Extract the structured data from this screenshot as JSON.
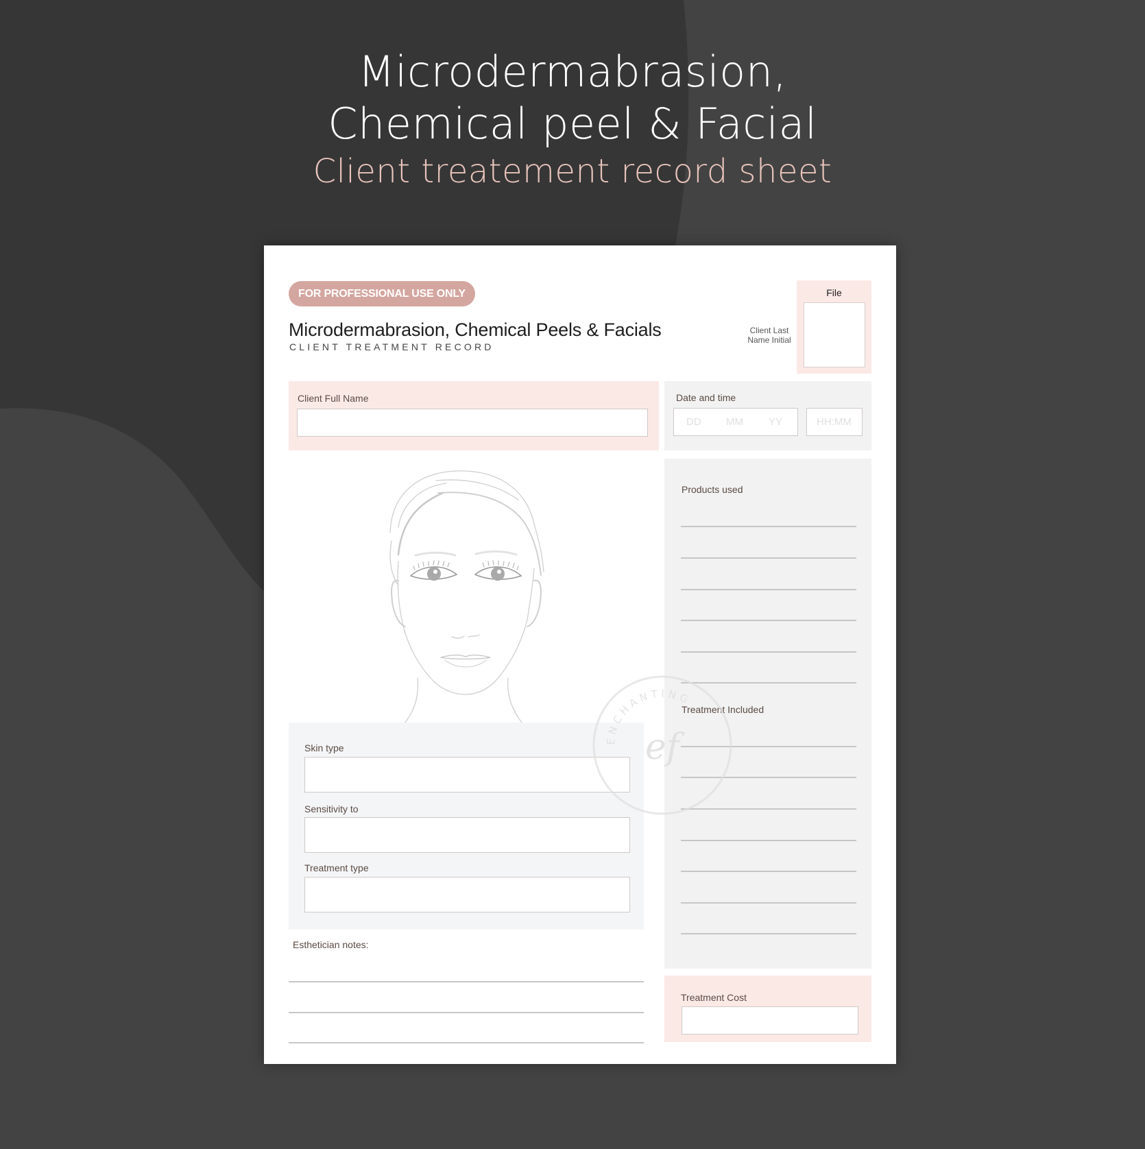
{
  "hero": {
    "line1": "Microdermabrasion,",
    "line2": "Chemical peel & Facial",
    "subtitle": "Client treatement record sheet"
  },
  "colors": {
    "background_dark": "#363636",
    "background_mid": "#434343",
    "accent_pink": "#d4a6a0",
    "panel_pink": "#fbe9e6",
    "panel_gray": "#f2f2f2",
    "subtitle_pink": "#e8c4bb"
  },
  "document": {
    "badge": "FOR PROFESSIONAL USE ONLY",
    "title": "Microdermabrasion, Chemical Peels & Facials",
    "subtitle": "CLIENT TREATMENT RECORD",
    "initial_label_line1": "Client Last",
    "initial_label_line2": "Name Initial",
    "file_label": "File",
    "client_name": {
      "label": "Client Full Name",
      "value": ""
    },
    "date_time": {
      "label": "Date and time",
      "day_placeholder": "DD",
      "month_placeholder": "MM",
      "year_placeholder": "YY",
      "time_placeholder": "HH:MM"
    },
    "face_chart": {
      "icon": "face-outline-icon"
    },
    "skin_type": {
      "label": "Skin type",
      "value": ""
    },
    "sensitivity": {
      "label": "Sensitivity to",
      "value": ""
    },
    "treatment_type": {
      "label": "Treatment type",
      "value": ""
    },
    "notes": {
      "label": "Esthetician notes:",
      "lines": 3
    },
    "products_used": {
      "label": "Products used",
      "lines": 6
    },
    "treatment_included": {
      "label": "Treatment Included",
      "lines": 7
    },
    "treatment_cost": {
      "label": "Treatment Cost",
      "value": ""
    },
    "watermark": {
      "top_text": "ENCHANTING",
      "monogram": "ef",
      "icon": "watermark-stamp-icon"
    }
  }
}
